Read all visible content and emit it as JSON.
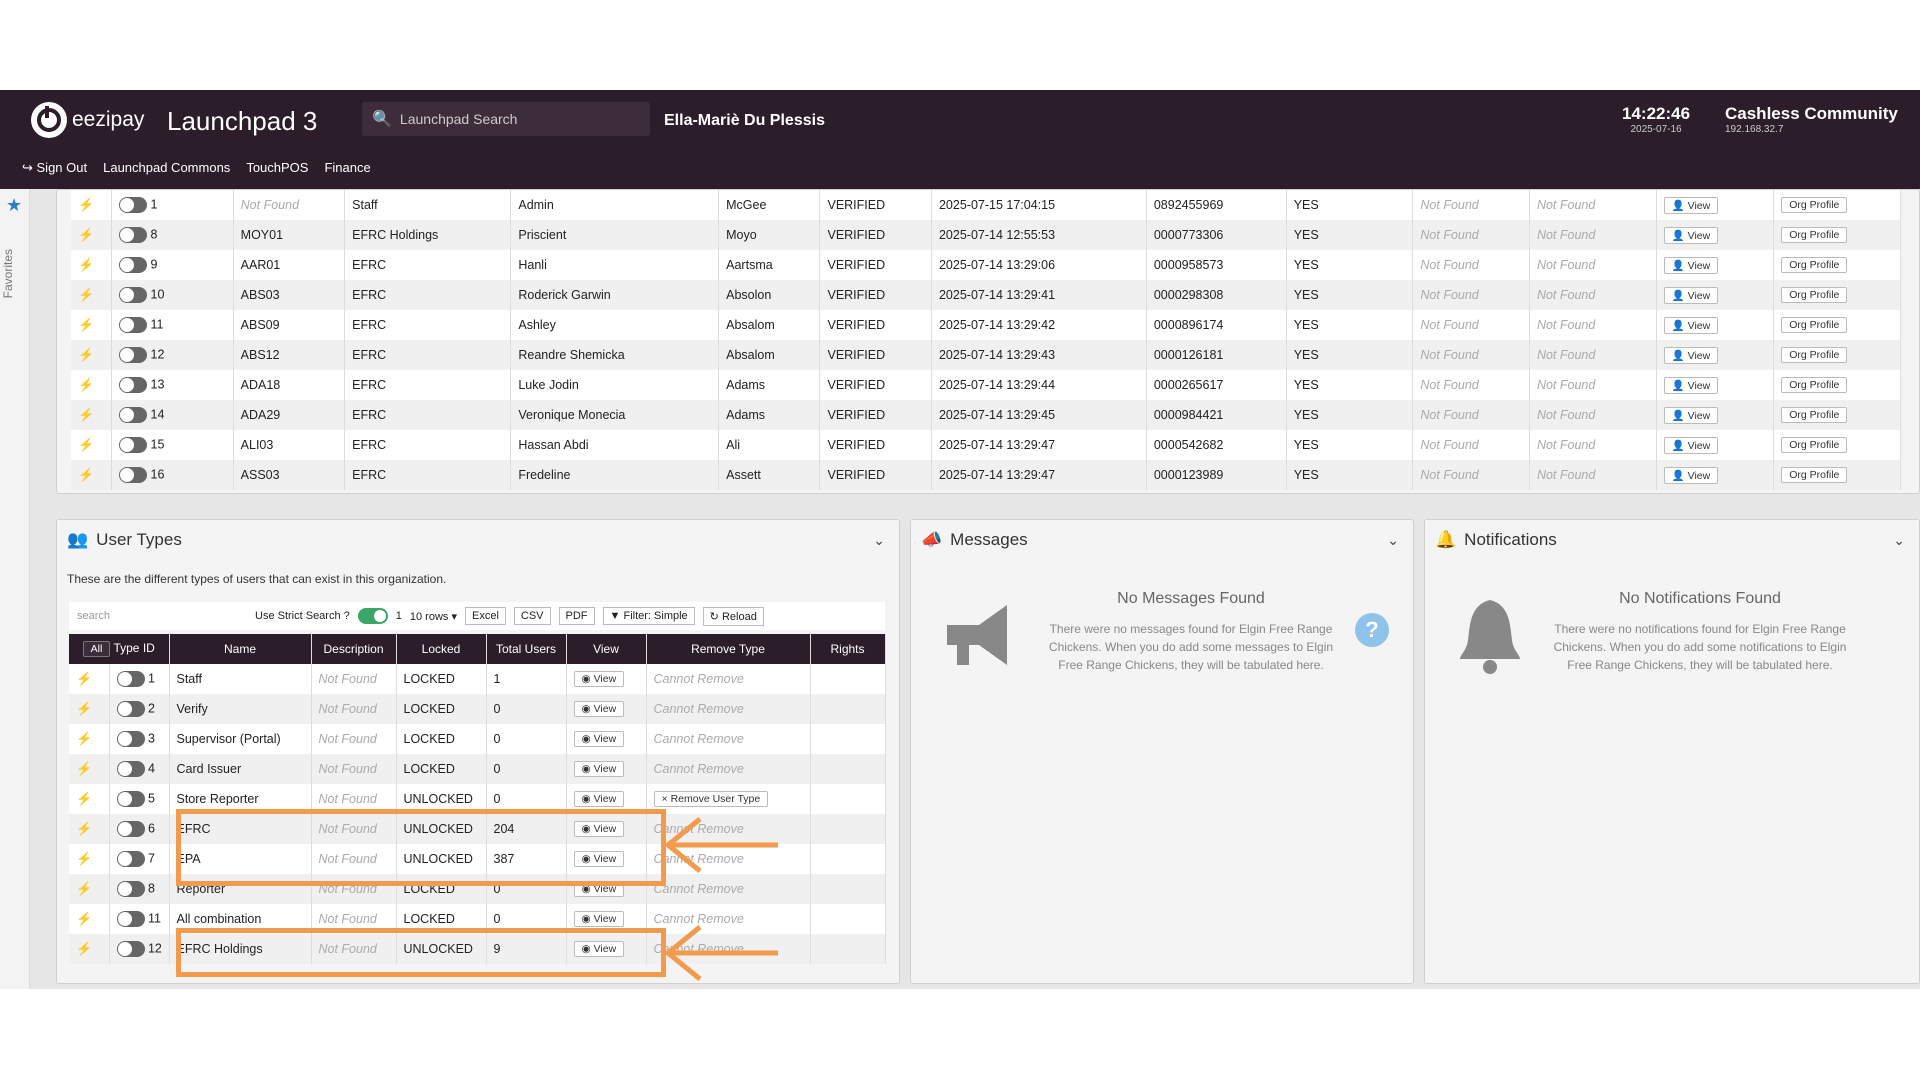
{
  "header": {
    "brand": "eezipay",
    "app_title": "Launchpad 3",
    "search_placeholder": "Launchpad Search",
    "user_name": "Ella-Mariè Du Plessis",
    "time": "14:22:46",
    "date": "2025-07-16",
    "org_name": "Cashless Community",
    "ip": "192.168.32.7"
  },
  "menu": [
    "Sign Out",
    "Launchpad Commons",
    "TouchPOS",
    "Finance"
  ],
  "favorites_label": "Favorites",
  "users_table": {
    "view_label": "View",
    "org_profile_label": "Org Profile",
    "rows": [
      {
        "id": "1",
        "code": "Not Found",
        "org": "Staff",
        "first": "Admin",
        "last": "McGee",
        "status": "VERIFIED",
        "modified": "2025-07-15 17:04:15",
        "card": "0892455969",
        "active": "YES",
        "f1": "Not Found",
        "f2": "Not Found"
      },
      {
        "id": "8",
        "code": "MOY01",
        "org": "EFRC Holdings",
        "first": "Priscient",
        "last": "Moyo",
        "status": "VERIFIED",
        "modified": "2025-07-14 12:55:53",
        "card": "0000773306",
        "active": "YES",
        "f1": "Not Found",
        "f2": "Not Found"
      },
      {
        "id": "9",
        "code": "AAR01",
        "org": "EFRC",
        "first": "Hanli",
        "last": "Aartsma",
        "status": "VERIFIED",
        "modified": "2025-07-14 13:29:06",
        "card": "0000958573",
        "active": "YES",
        "f1": "Not Found",
        "f2": "Not Found"
      },
      {
        "id": "10",
        "code": "ABS03",
        "org": "EFRC",
        "first": "Roderick Garwin",
        "last": "Absolon",
        "status": "VERIFIED",
        "modified": "2025-07-14 13:29:41",
        "card": "0000298308",
        "active": "YES",
        "f1": "Not Found",
        "f2": "Not Found"
      },
      {
        "id": "11",
        "code": "ABS09",
        "org": "EFRC",
        "first": "Ashley",
        "last": "Absalom",
        "status": "VERIFIED",
        "modified": "2025-07-14 13:29:42",
        "card": "0000896174",
        "active": "YES",
        "f1": "Not Found",
        "f2": "Not Found"
      },
      {
        "id": "12",
        "code": "ABS12",
        "org": "EFRC",
        "first": "Reandre Shemicka",
        "last": "Absalom",
        "status": "VERIFIED",
        "modified": "2025-07-14 13:29:43",
        "card": "0000126181",
        "active": "YES",
        "f1": "Not Found",
        "f2": "Not Found"
      },
      {
        "id": "13",
        "code": "ADA18",
        "org": "EFRC",
        "first": "Luke Jodin",
        "last": "Adams",
        "status": "VERIFIED",
        "modified": "2025-07-14 13:29:44",
        "card": "0000265617",
        "active": "YES",
        "f1": "Not Found",
        "f2": "Not Found"
      },
      {
        "id": "14",
        "code": "ADA29",
        "org": "EFRC",
        "first": "Veronique Monecia",
        "last": "Adams",
        "status": "VERIFIED",
        "modified": "2025-07-14 13:29:45",
        "card": "0000984421",
        "active": "YES",
        "f1": "Not Found",
        "f2": "Not Found"
      },
      {
        "id": "15",
        "code": "ALI03",
        "org": "EFRC",
        "first": "Hassan Abdi",
        "last": "Ali",
        "status": "VERIFIED",
        "modified": "2025-07-14 13:29:47",
        "card": "0000542682",
        "active": "YES",
        "f1": "Not Found",
        "f2": "Not Found"
      },
      {
        "id": "16",
        "code": "ASS03",
        "org": "EFRC",
        "first": "Fredeline",
        "last": "Assett",
        "status": "VERIFIED",
        "modified": "2025-07-14 13:29:47",
        "card": "0000123989",
        "active": "YES",
        "f1": "Not Found",
        "f2": "Not Found"
      }
    ]
  },
  "user_types": {
    "title": "User Types",
    "description": "These are the different types of users that can exist in this organization.",
    "toolbar": {
      "search_placeholder": "search",
      "strict_label": "Use Strict Search ?",
      "page": "1",
      "rows_select": "10 rows",
      "excel": "Excel",
      "csv": "CSV",
      "pdf": "PDF",
      "filter": "Filter: Simple",
      "reload": "Reload"
    },
    "columns": {
      "all": "All",
      "type_id": "Type ID",
      "name": "Name",
      "description": "Description",
      "locked": "Locked",
      "total_users": "Total Users",
      "view": "View",
      "remove_type": "Remove Type",
      "rights": "Rights"
    },
    "view_label": "View",
    "rows": [
      {
        "id": "1",
        "name": "Staff",
        "desc": "Not Found",
        "locked": "LOCKED",
        "total": "1",
        "remove": "Cannot Remove"
      },
      {
        "id": "2",
        "name": "Verify",
        "desc": "Not Found",
        "locked": "LOCKED",
        "total": "0",
        "remove": "Cannot Remove"
      },
      {
        "id": "3",
        "name": "Supervisor (Portal)",
        "desc": "Not Found",
        "locked": "LOCKED",
        "total": "0",
        "remove": "Cannot Remove"
      },
      {
        "id": "4",
        "name": "Card Issuer",
        "desc": "Not Found",
        "locked": "LOCKED",
        "total": "0",
        "remove": "Cannot Remove"
      },
      {
        "id": "5",
        "name": "Store Reporter",
        "desc": "Not Found",
        "locked": "UNLOCKED",
        "total": "0",
        "remove": "Remove User Type"
      },
      {
        "id": "6",
        "name": "EFRC",
        "desc": "Not Found",
        "locked": "UNLOCKED",
        "total": "204",
        "remove": "Cannot Remove"
      },
      {
        "id": "7",
        "name": "EPA",
        "desc": "Not Found",
        "locked": "UNLOCKED",
        "total": "387",
        "remove": "Cannot Remove"
      },
      {
        "id": "8",
        "name": "Reporter",
        "desc": "Not Found",
        "locked": "LOCKED",
        "total": "0",
        "remove": "Cannot Remove"
      },
      {
        "id": "11",
        "name": "All combination",
        "desc": "Not Found",
        "locked": "LOCKED",
        "total": "0",
        "remove": "Cannot Remove"
      },
      {
        "id": "12",
        "name": "EFRC Holdings",
        "desc": "Not Found",
        "locked": "UNLOCKED",
        "total": "9",
        "remove": "Cannot Remove"
      }
    ]
  },
  "messages": {
    "title": "Messages",
    "empty_title": "No Messages Found",
    "empty_text": "There were no messages found for Elgin Free Range Chickens. When you do add some messages to Elgin Free Range Chickens, they will be tabulated here."
  },
  "notifications": {
    "title": "Notifications",
    "empty_title": "No Notifications Found",
    "empty_text": "There were no notifications found for Elgin Free Range Chickens. When you do add some notifications to Elgin Free Range Chickens, they will be tabulated here."
  },
  "colors": {
    "topbar": "#2c1d2a",
    "highlight": "#f39a4c",
    "accent": "#2e7dc7"
  }
}
